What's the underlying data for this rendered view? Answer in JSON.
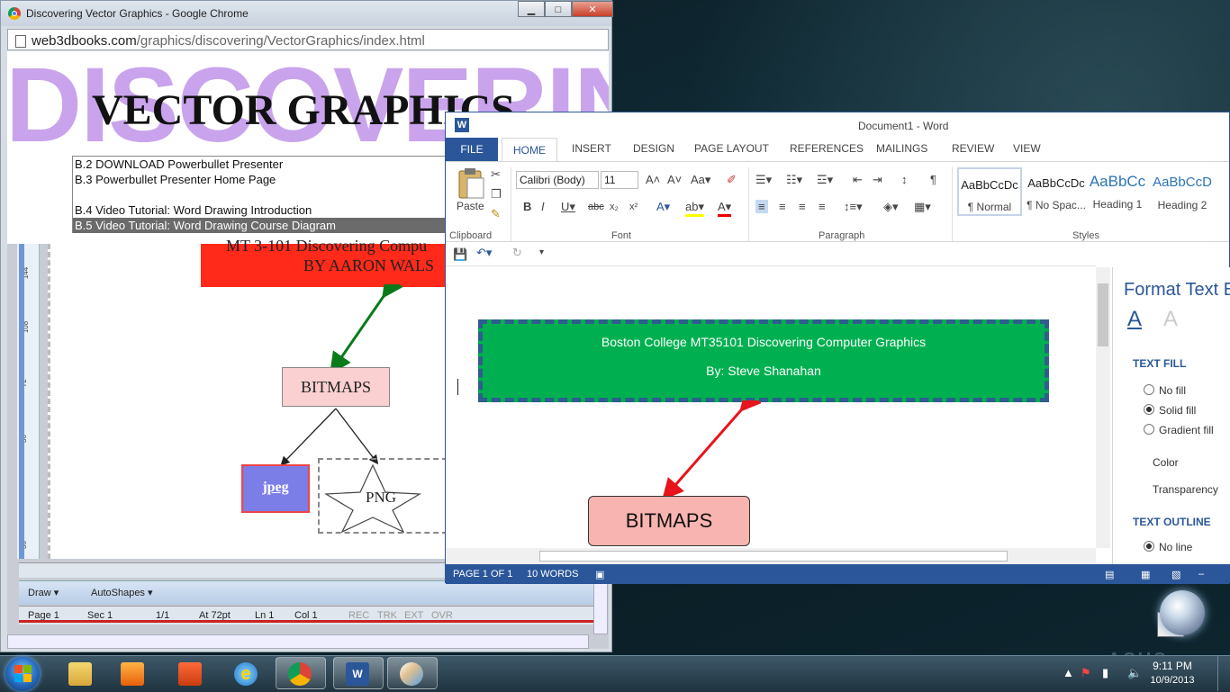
{
  "chrome": {
    "title": "Discovering Vector Graphics - Google Chrome",
    "url_domain": "web3dbooks.com",
    "url_path": "/graphics/discovering/VectorGraphics/index.html",
    "banner_bg_text": "DISCOVERING",
    "banner_title": "VECTOR GRAPHICS",
    "list_items": [
      "B.2 DOWNLOAD Powerbullet Presenter",
      "B.3 Powerbullet Presenter Home Page",
      "",
      "B.4 Video Tutorial: Word Drawing Introduction",
      "B.5 Video Tutorial: Word Drawing Course Diagram"
    ],
    "window_buttons": {
      "minimize": "▁",
      "maximize": "□",
      "close": "✕"
    }
  },
  "old_word": {
    "red_box_line1": "MT 3-101 Discovering Compu",
    "red_box_line2": "BY AARON WALS",
    "bitmaps": "BITMAPS",
    "jpeg": "jpeg",
    "png": "PNG",
    "ruler_marks": [
      "144",
      "108",
      "72",
      "36",
      "36"
    ],
    "drawing_toolbar": {
      "draw": "Draw ▾",
      "autoshapes": "AutoShapes ▾"
    },
    "status": {
      "page": "Page  1",
      "sec": "Sec  1",
      "pages": "1/1",
      "at": "At  72pt",
      "ln": "Ln  1",
      "col": "Col  1",
      "rec": "REC",
      "trk": "TRK",
      "ext": "EXT",
      "ovr": "OVR"
    }
  },
  "word": {
    "title": "Document1 - Word",
    "logo": "W",
    "tabs": {
      "file": "FILE",
      "home": "HOME",
      "insert": "INSERT",
      "design": "DESIGN",
      "page_layout": "PAGE LAYOUT",
      "references": "REFERENCES",
      "mailings": "MAILINGS",
      "review": "REVIEW",
      "view": "VIEW"
    },
    "clipboard": {
      "paste": "Paste",
      "label": "Clipboard"
    },
    "font": {
      "name": "Calibri (Body)",
      "size": "11",
      "label": "Font"
    },
    "paragraph_label": "Paragraph",
    "styles": {
      "label": "Styles",
      "items": [
        {
          "preview": "AaBbCcDc",
          "name": "¶ Normal"
        },
        {
          "preview": "AaBbCcDc",
          "name": "¶ No Spac..."
        },
        {
          "preview": "AaBbCc",
          "name": "Heading 1"
        },
        {
          "preview": "AaBbCcD",
          "name": "Heading 2"
        }
      ]
    },
    "doc": {
      "green_line1": "Boston College MT35101 Discovering Computer Graphics",
      "green_line2": "By: Steve Shanahan",
      "bitmaps": "BITMAPS"
    },
    "status": {
      "page": "PAGE 1 OF 1",
      "words": "10 WORDS"
    },
    "pane": {
      "title": "Format Text E",
      "text_fill": "TEXT FILL",
      "no_fill": "No fill",
      "solid_fill": "Solid fill",
      "gradient_fill": "Gradient fill",
      "color": "Color",
      "transparency": "Transparency",
      "text_outline": "TEXT OUTLINE",
      "no_line": "No line",
      "selected_fill": "Solid fill"
    }
  },
  "taskbar": {
    "time": "9:11 PM",
    "date": "10/9/2013",
    "apps": [
      "file-explorer-icon",
      "media-player-icon",
      "office-icon",
      "internet-explorer-icon",
      "chrome-icon",
      "word-icon",
      "paint-icon"
    ]
  },
  "desktop": {
    "asus": "ASUS"
  },
  "colors": {
    "word_blue": "#2b579a",
    "green_box": "#00b050",
    "bitmaps_pink": "#f8b4b0",
    "banner_purple": "#c9a4ec",
    "arrow_red": "#e8141b"
  }
}
